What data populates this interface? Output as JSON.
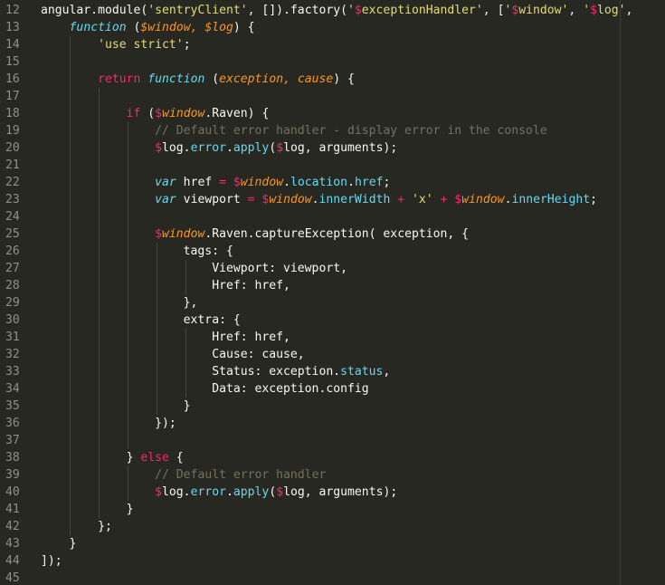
{
  "editor": {
    "colors": {
      "background": "#272822",
      "plain": "#f8f8f2",
      "string": "#e6db74",
      "keyword": "#f92672",
      "function_keyword": "#66d9ef",
      "param": "#fd971f",
      "identifier": "#a6e22e",
      "comment": "#75715e",
      "line_number": "#8f908a"
    },
    "lines": [
      {
        "number": "12",
        "tokens": [
          {
            "t": "angular.module(",
            "c": "p"
          },
          {
            "t": "'sentryClient'",
            "c": "s"
          },
          {
            "t": ", []).factory(",
            "c": "p"
          },
          {
            "t": "'",
            "c": "s"
          },
          {
            "t": "$",
            "c": "d"
          },
          {
            "t": "exceptionHandler'",
            "c": "s"
          },
          {
            "t": ", [",
            "c": "p"
          },
          {
            "t": "'",
            "c": "s"
          },
          {
            "t": "$",
            "c": "d"
          },
          {
            "t": "window'",
            "c": "s"
          },
          {
            "t": ", ",
            "c": "p"
          },
          {
            "t": "'",
            "c": "s"
          },
          {
            "t": "$",
            "c": "d"
          },
          {
            "t": "log'",
            "c": "s"
          },
          {
            "t": ",",
            "c": "p"
          }
        ]
      },
      {
        "number": "13",
        "tokens": [
          {
            "t": "    ",
            "c": "p"
          },
          {
            "t": "function",
            "c": "f"
          },
          {
            "t": " (",
            "c": "p"
          },
          {
            "t": "$window, $log",
            "c": "a"
          },
          {
            "t": ") {",
            "c": "p"
          }
        ]
      },
      {
        "number": "14",
        "tokens": [
          {
            "t": "        ",
            "c": "p"
          },
          {
            "t": "'use strict'",
            "c": "s"
          },
          {
            "t": ";",
            "c": "p"
          }
        ]
      },
      {
        "number": "15",
        "tokens": []
      },
      {
        "number": "16",
        "tokens": [
          {
            "t": "        ",
            "c": "p"
          },
          {
            "t": "return",
            "c": "k"
          },
          {
            "t": " ",
            "c": "p"
          },
          {
            "t": "function",
            "c": "f"
          },
          {
            "t": " (",
            "c": "p"
          },
          {
            "t": "exception, cause",
            "c": "a"
          },
          {
            "t": ") {",
            "c": "p"
          }
        ]
      },
      {
        "number": "17",
        "tokens": []
      },
      {
        "number": "18",
        "tokens": [
          {
            "t": "            ",
            "c": "p"
          },
          {
            "t": "if",
            "c": "k"
          },
          {
            "t": " (",
            "c": "p"
          },
          {
            "t": "$",
            "c": "d"
          },
          {
            "t": "window",
            "c": "a"
          },
          {
            "t": ".Raven) {",
            "c": "p"
          }
        ]
      },
      {
        "number": "19",
        "tokens": [
          {
            "t": "                ",
            "c": "p"
          },
          {
            "t": "// Default error handler - display error in the console",
            "c": "c"
          }
        ]
      },
      {
        "number": "20",
        "tokens": [
          {
            "t": "                ",
            "c": "p"
          },
          {
            "t": "$",
            "c": "d"
          },
          {
            "t": "log.",
            "c": "p"
          },
          {
            "t": "error",
            "c": "n"
          },
          {
            "t": ".",
            "c": "p"
          },
          {
            "t": "apply",
            "c": "n"
          },
          {
            "t": "(",
            "c": "p"
          },
          {
            "t": "$",
            "c": "d"
          },
          {
            "t": "log, arguments);",
            "c": "p"
          }
        ]
      },
      {
        "number": "21",
        "tokens": []
      },
      {
        "number": "22",
        "tokens": [
          {
            "t": "                ",
            "c": "p"
          },
          {
            "t": "var",
            "c": "f"
          },
          {
            "t": " href ",
            "c": "p"
          },
          {
            "t": "=",
            "c": "k"
          },
          {
            "t": " ",
            "c": "p"
          },
          {
            "t": "$",
            "c": "d"
          },
          {
            "t": "window",
            "c": "a"
          },
          {
            "t": ".",
            "c": "p"
          },
          {
            "t": "location",
            "c": "n"
          },
          {
            "t": ".",
            "c": "p"
          },
          {
            "t": "href",
            "c": "n"
          },
          {
            "t": ";",
            "c": "p"
          }
        ]
      },
      {
        "number": "23",
        "tokens": [
          {
            "t": "                ",
            "c": "p"
          },
          {
            "t": "var",
            "c": "f"
          },
          {
            "t": " viewport ",
            "c": "p"
          },
          {
            "t": "=",
            "c": "k"
          },
          {
            "t": " ",
            "c": "p"
          },
          {
            "t": "$",
            "c": "d"
          },
          {
            "t": "window",
            "c": "a"
          },
          {
            "t": ".",
            "c": "p"
          },
          {
            "t": "innerWidth",
            "c": "n"
          },
          {
            "t": " ",
            "c": "p"
          },
          {
            "t": "+",
            "c": "k"
          },
          {
            "t": " ",
            "c": "p"
          },
          {
            "t": "'x'",
            "c": "s"
          },
          {
            "t": " ",
            "c": "p"
          },
          {
            "t": "+",
            "c": "k"
          },
          {
            "t": " ",
            "c": "p"
          },
          {
            "t": "$",
            "c": "d"
          },
          {
            "t": "window",
            "c": "a"
          },
          {
            "t": ".",
            "c": "p"
          },
          {
            "t": "innerHeight",
            "c": "n"
          },
          {
            "t": ";",
            "c": "p"
          }
        ]
      },
      {
        "number": "24",
        "tokens": []
      },
      {
        "number": "25",
        "tokens": [
          {
            "t": "                ",
            "c": "p"
          },
          {
            "t": "$",
            "c": "d"
          },
          {
            "t": "window",
            "c": "a"
          },
          {
            "t": ".Raven.captureException( exception, {",
            "c": "p"
          }
        ]
      },
      {
        "number": "26",
        "tokens": [
          {
            "t": "                    tags: {",
            "c": "p"
          }
        ]
      },
      {
        "number": "27",
        "tokens": [
          {
            "t": "                        Viewport: viewport,",
            "c": "p"
          }
        ]
      },
      {
        "number": "28",
        "tokens": [
          {
            "t": "                        Href: href,",
            "c": "p"
          }
        ]
      },
      {
        "number": "29",
        "tokens": [
          {
            "t": "                    },",
            "c": "p"
          }
        ]
      },
      {
        "number": "30",
        "tokens": [
          {
            "t": "                    extra: {",
            "c": "p"
          }
        ]
      },
      {
        "number": "31",
        "tokens": [
          {
            "t": "                        Href: href,",
            "c": "p"
          }
        ]
      },
      {
        "number": "32",
        "tokens": [
          {
            "t": "                        Cause: cause,",
            "c": "p"
          }
        ]
      },
      {
        "number": "33",
        "tokens": [
          {
            "t": "                        Status: exception.",
            "c": "p"
          },
          {
            "t": "status",
            "c": "n"
          },
          {
            "t": ",",
            "c": "p"
          }
        ]
      },
      {
        "number": "34",
        "tokens": [
          {
            "t": "                        Data: exception.config",
            "c": "p"
          }
        ]
      },
      {
        "number": "35",
        "tokens": [
          {
            "t": "                    }",
            "c": "p"
          }
        ]
      },
      {
        "number": "36",
        "tokens": [
          {
            "t": "                });",
            "c": "p"
          }
        ]
      },
      {
        "number": "37",
        "tokens": []
      },
      {
        "number": "38",
        "tokens": [
          {
            "t": "            } ",
            "c": "p"
          },
          {
            "t": "else",
            "c": "k"
          },
          {
            "t": " {",
            "c": "p"
          }
        ]
      },
      {
        "number": "39",
        "tokens": [
          {
            "t": "                ",
            "c": "p"
          },
          {
            "t": "// Default error handler",
            "c": "c"
          }
        ]
      },
      {
        "number": "40",
        "tokens": [
          {
            "t": "                ",
            "c": "p"
          },
          {
            "t": "$",
            "c": "d"
          },
          {
            "t": "log.",
            "c": "p"
          },
          {
            "t": "error",
            "c": "n"
          },
          {
            "t": ".",
            "c": "p"
          },
          {
            "t": "apply",
            "c": "n"
          },
          {
            "t": "(",
            "c": "p"
          },
          {
            "t": "$",
            "c": "d"
          },
          {
            "t": "log, arguments);",
            "c": "p"
          }
        ]
      },
      {
        "number": "41",
        "tokens": [
          {
            "t": "            }",
            "c": "p"
          }
        ]
      },
      {
        "number": "42",
        "tokens": [
          {
            "t": "        };",
            "c": "p"
          }
        ]
      },
      {
        "number": "43",
        "tokens": [
          {
            "t": "    }",
            "c": "p"
          }
        ]
      },
      {
        "number": "44",
        "tokens": [
          {
            "t": "]);",
            "c": "p"
          }
        ]
      },
      {
        "number": "45",
        "tokens": []
      }
    ]
  }
}
